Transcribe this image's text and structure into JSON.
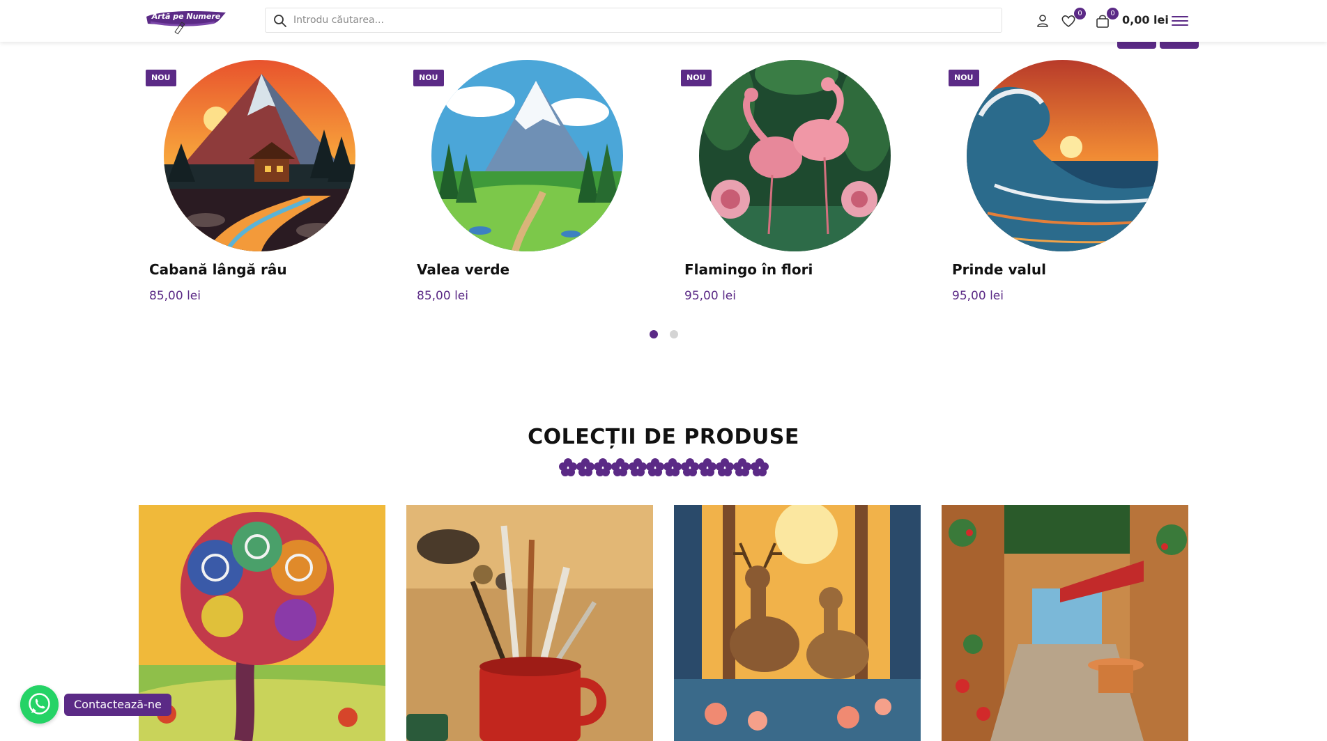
{
  "brand": {
    "logo_text": "Artă pe Numere"
  },
  "search": {
    "placeholder": "Introdu căutarea..."
  },
  "header": {
    "wishlist_count": "0",
    "cart_count": "0",
    "cart_total": "0,00 lei"
  },
  "products": [
    {
      "badge": "NOU",
      "title": "Cabană lângă râu",
      "price": "85,00 lei"
    },
    {
      "badge": "NOU",
      "title": "Valea verde",
      "price": "85,00 lei"
    },
    {
      "badge": "NOU",
      "title": "Flamingo în flori",
      "price": "95,00 lei"
    },
    {
      "badge": "NOU",
      "title": "Prinde valul",
      "price": "95,00 lei"
    }
  ],
  "carousel": {
    "pages": 2,
    "active_page": 1
  },
  "collections": {
    "title": "COLECȚII DE PRODUSE"
  },
  "contact": {
    "label": "Contactează-ne"
  },
  "colors": {
    "brand": "#5b2a86",
    "whatsapp": "#25d366"
  }
}
